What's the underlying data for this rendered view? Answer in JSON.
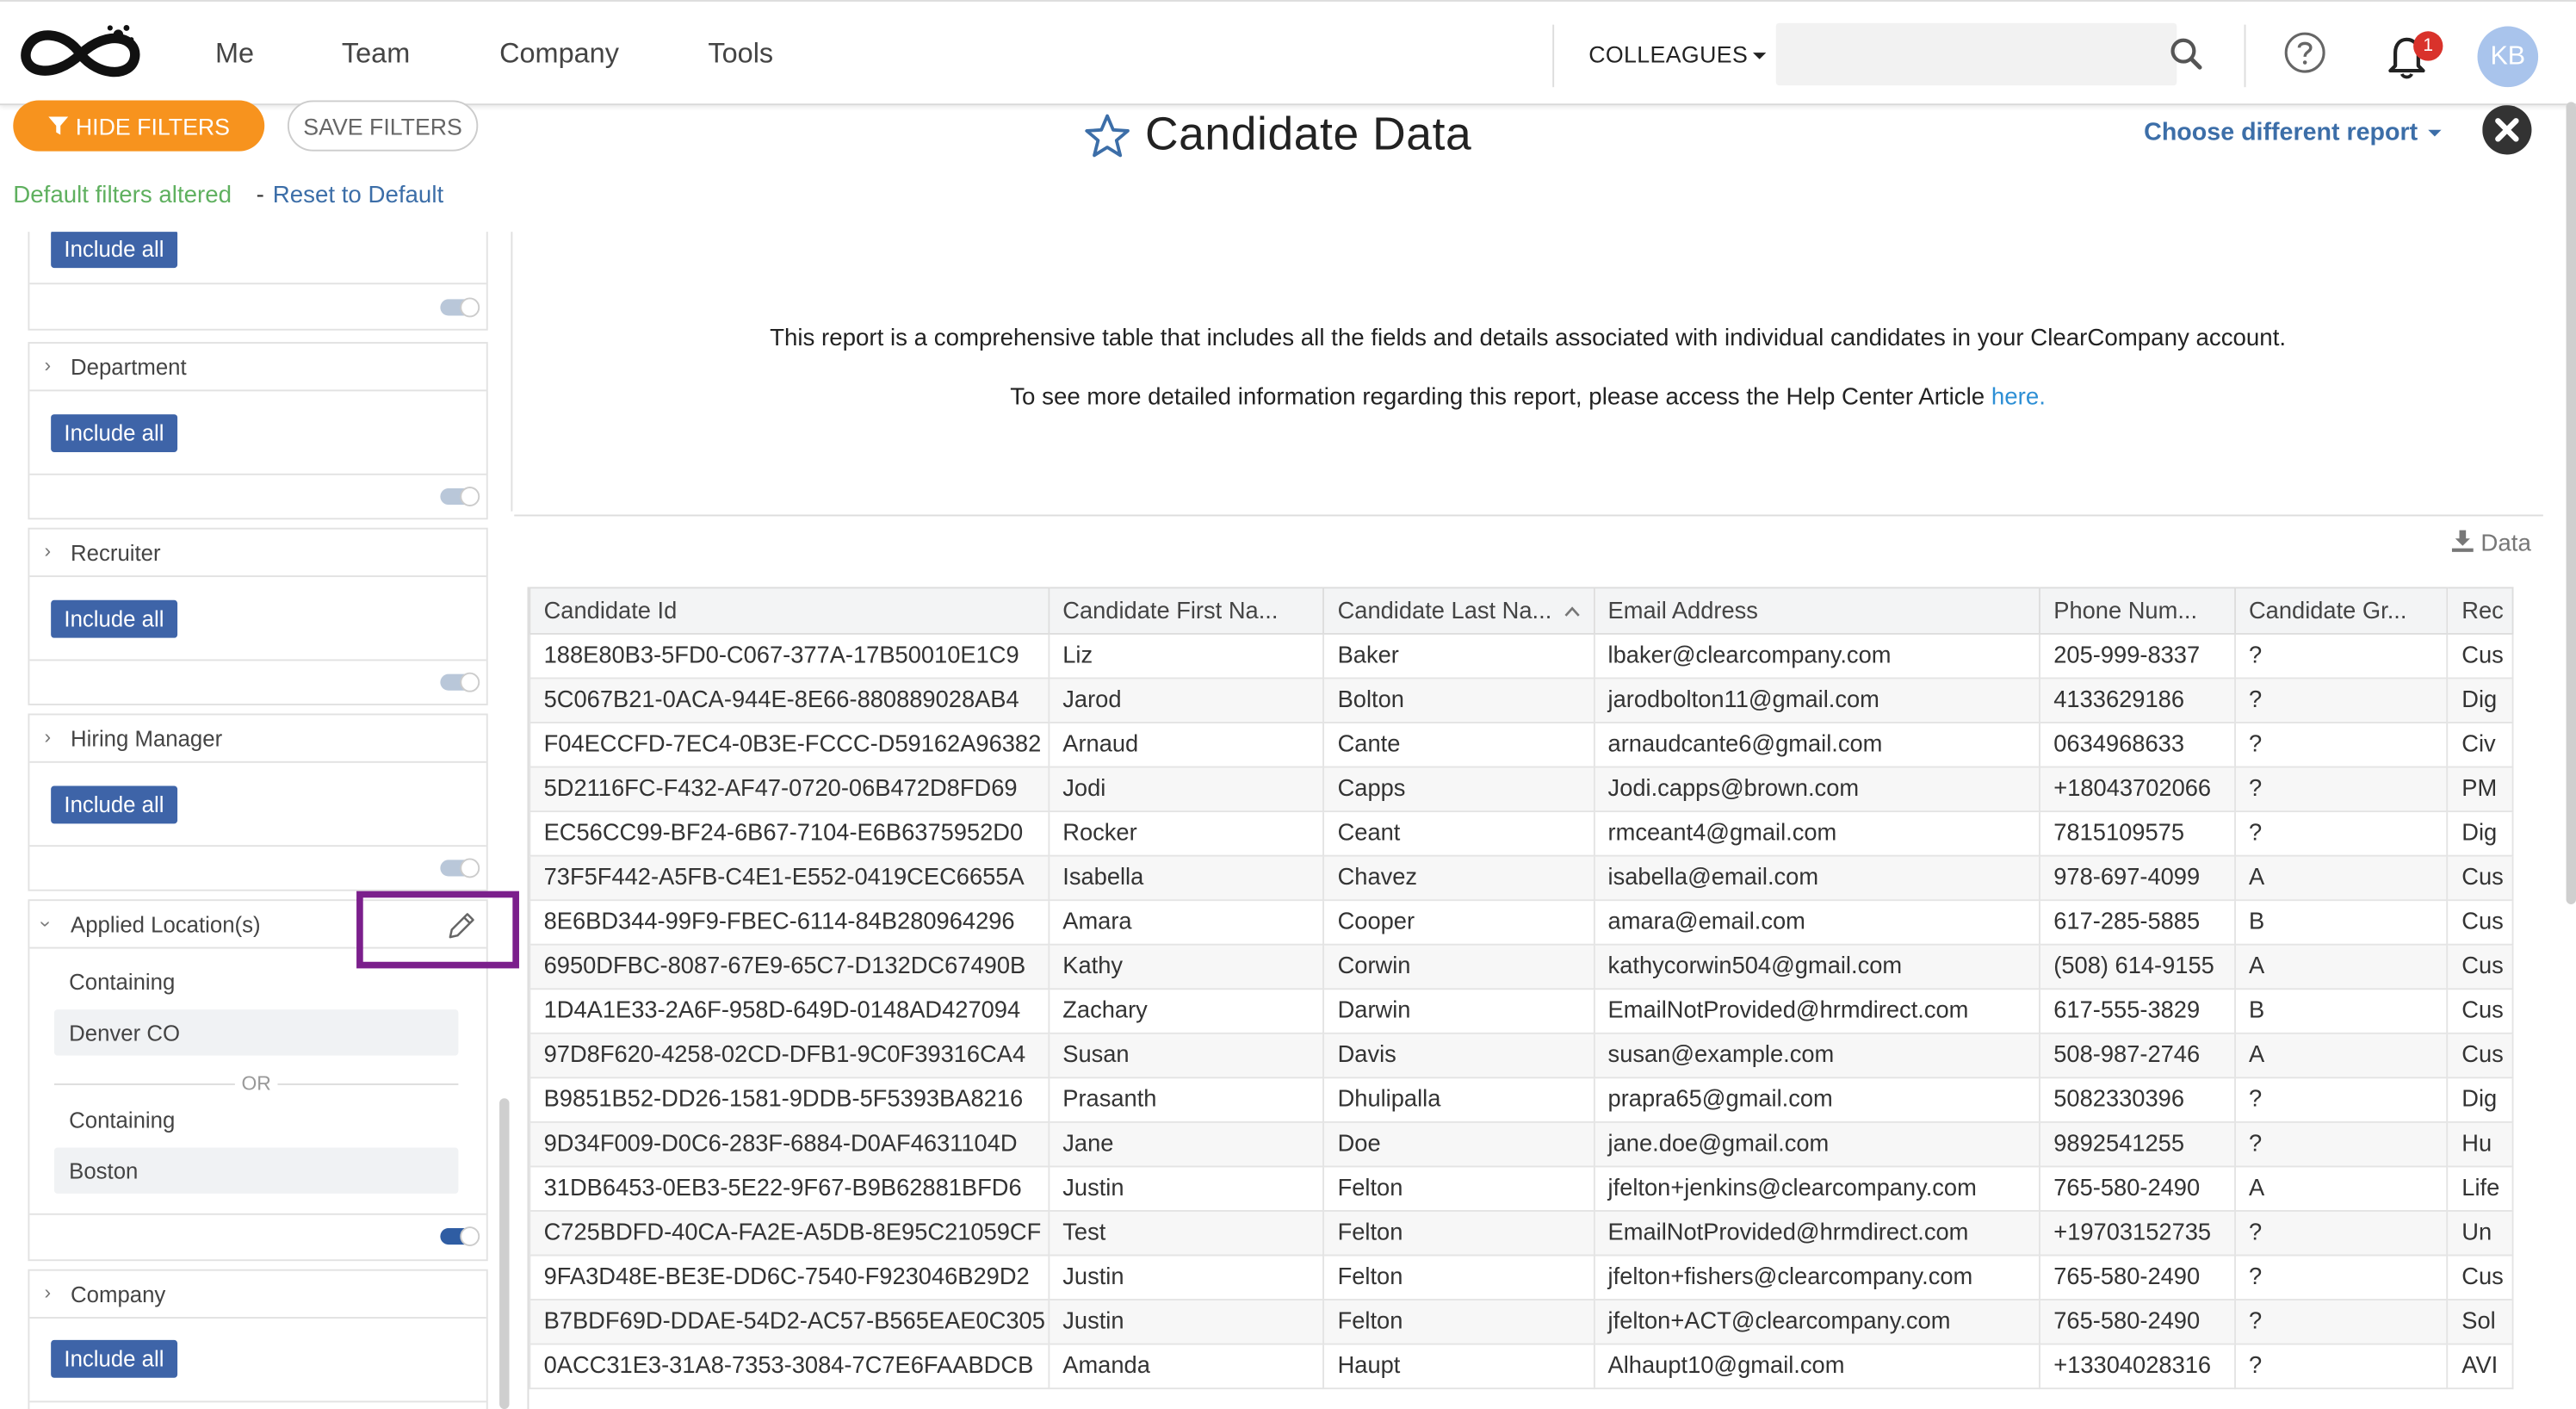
{
  "nav": {
    "links": [
      "Me",
      "Team",
      "Company",
      "Tools"
    ],
    "colleagues_label": "COLLEAGUES",
    "search_placeholder": "",
    "notification_count": "1",
    "avatar_initials": "KB"
  },
  "toolbar": {
    "hide_filters_label": "HIDE FILTERS",
    "save_filters_label": "SAVE FILTERS",
    "altered_text": "Default filters altered",
    "separator": "-",
    "reset_label": "Reset to Default"
  },
  "report": {
    "title": "Candidate Data",
    "choose_label": "Choose different report",
    "description": "This report is a comprehensive table that includes all the fields and details associated with individual candidates in your ClearCompany account.",
    "help_prefix": "To see more detailed information regarding this report, please access the Help Center Article",
    "help_link": "here.",
    "download_label": "Data"
  },
  "filters": {
    "include_all_label": "Include all",
    "department": "Department",
    "recruiter": "Recruiter",
    "hiring_manager": "Hiring Manager",
    "applied_location": "Applied Location(s)",
    "containing_label": "Containing",
    "or_label": "OR",
    "location_value_1": "Denver CO",
    "location_value_2": "Boston",
    "company": "Company"
  },
  "table": {
    "columns": [
      "Candidate Id",
      "Candidate First Na...",
      "Candidate Last Na...",
      "Email Address",
      "Phone Num...",
      "Candidate Gr...",
      "Rec"
    ],
    "rows": [
      [
        "188E80B3-5FD0-C067-377A-17B50010E1C9",
        "Liz",
        "Baker",
        "lbaker@clearcompany.com",
        "205-999-8337",
        "?",
        "Cus"
      ],
      [
        "5C067B21-0ACA-944E-8E66-880889028AB4",
        "Jarod",
        "Bolton",
        "jarodbolton11@gmail.com",
        "4133629186",
        "?",
        "Dig"
      ],
      [
        "F04ECCFD-7EC4-0B3E-FCCC-D59162A96382",
        "Arnaud",
        "Cante",
        "arnaudcante6@gmail.com",
        "0634968633",
        "?",
        "Civ"
      ],
      [
        "5D2116FC-F432-AF47-0720-06B472D8FD69",
        "Jodi",
        "Capps",
        "Jodi.capps@brown.com",
        "+18043702066",
        "?",
        "PM"
      ],
      [
        "EC56CC99-BF24-6B67-7104-E6B6375952D0",
        "Rocker",
        "Ceant",
        "rmceant4@gmail.com",
        "7815109575",
        "?",
        "Dig"
      ],
      [
        "73F5F442-A5FB-C4E1-E552-0419CEC6655A",
        "Isabella",
        "Chavez",
        "isabella@email.com",
        "978-697-4099",
        "A",
        "Cus"
      ],
      [
        "8E6BD344-99F9-FBEC-6114-84B280964296",
        "Amara",
        "Cooper",
        "amara@email.com",
        "617-285-5885",
        "B",
        "Cus"
      ],
      [
        "6950DFBC-8087-67E9-65C7-D132DC67490B",
        "Kathy",
        "Corwin",
        "kathycorwin504@gmail.com",
        "(508) 614-9155",
        "A",
        "Cus"
      ],
      [
        "1D4A1E33-2A6F-958D-649D-0148AD427094",
        "Zachary",
        "Darwin",
        "EmailNotProvided@hrmdirect.com",
        "617-555-3829",
        "B",
        "Cus"
      ],
      [
        "97D8F620-4258-02CD-DFB1-9C0F39316CA4",
        "Susan",
        "Davis",
        "susan@example.com",
        "508-987-2746",
        "A",
        "Cus"
      ],
      [
        "B9851B52-DD26-1581-9DDB-5F5393BA8216",
        "Prasanth",
        "Dhulipalla",
        "prapra65@gmail.com",
        "5082330396",
        "?",
        "Dig"
      ],
      [
        "9D34F009-D0C6-283F-6884-D0AF4631104D",
        "Jane",
        "Doe",
        "jane.doe@gmail.com",
        "9892541255",
        "?",
        "Hu"
      ],
      [
        "31DB6453-0EB3-5E22-9F67-B9B62881BFD6",
        "Justin",
        "Felton",
        "jfelton+jenkins@clearcompany.com",
        "765-580-2490",
        "A",
        "Life"
      ],
      [
        "C725BDFD-40CA-FA2E-A5DB-8E95C21059CF",
        "Test",
        "Felton",
        "EmailNotProvided@hrmdirect.com",
        "+19703152735",
        "?",
        "Un"
      ],
      [
        "9FA3D48E-BE3E-DD6C-7540-F923046B29D2",
        "Justin",
        "Felton",
        "jfelton+fishers@clearcompany.com",
        "765-580-2490",
        "?",
        "Cus"
      ],
      [
        "B7BDF69D-DDAE-54D2-AC57-B565EAE0C305",
        "Justin",
        "Felton",
        "jfelton+ACT@clearcompany.com",
        "765-580-2490",
        "?",
        "Sol"
      ],
      [
        "0ACC31E3-31A8-7353-3084-7C7E6FAABDCB",
        "Amanda",
        "Haupt",
        "Alhaupt10@gmail.com",
        "+13304028316",
        "?",
        "AVI"
      ]
    ]
  }
}
